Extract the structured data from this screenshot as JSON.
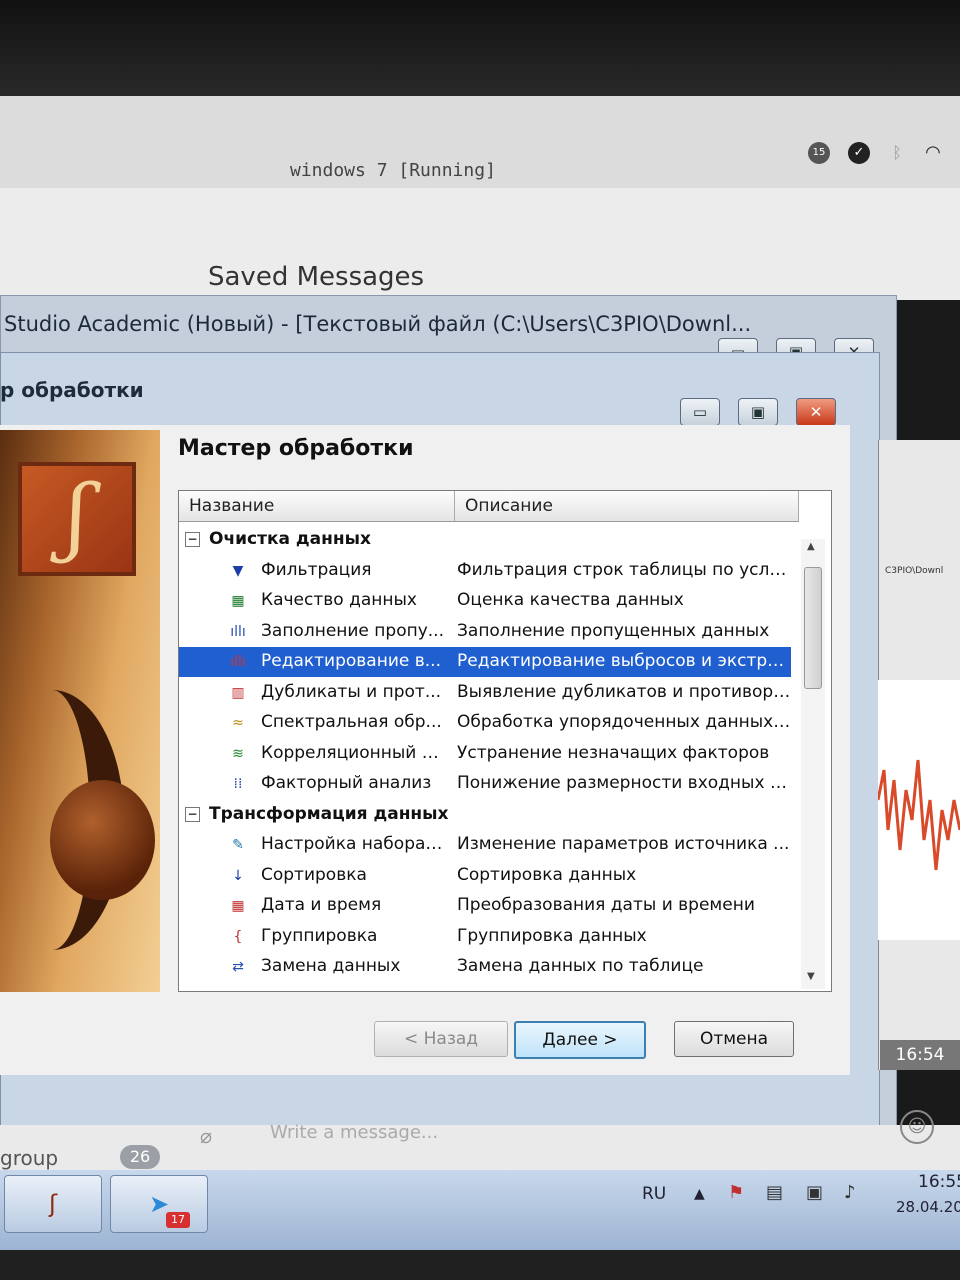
{
  "host": {
    "vm_title": "windows 7 [Running]",
    "telegram_chat_title": "Saved Messages",
    "tray_badge": "15"
  },
  "studio_window": {
    "title": "Studio Academic (Новый) - [Текстовый файл (C:\\Users\\C3PIO\\Downl..."
  },
  "wizard": {
    "title": "р обработки",
    "heading": "Мастер обработки",
    "columns": [
      "Название",
      "Описание"
    ],
    "groups": [
      {
        "label": "Очистка данных",
        "toggle": "−",
        "items": [
          {
            "icon": "funnel-icon",
            "glyph": "▼",
            "color": "#1a3fa8",
            "name": "Фильтрация",
            "desc": "Фильтрация строк таблицы по усло..."
          },
          {
            "icon": "quality-icon",
            "glyph": "▦",
            "color": "#1b7a2d",
            "name": "Качество данных",
            "desc": "Оценка качества данных"
          },
          {
            "icon": "fill-gaps-icon",
            "glyph": "ıllı",
            "color": "#2a4fb0",
            "name": "Заполнение пропу...",
            "desc": "Заполнение пропущенных данных"
          },
          {
            "icon": "outliers-icon",
            "glyph": "ıllı",
            "color": "#d83030",
            "name": "Редактирование в...",
            "desc": "Редактирование выбросов и экстре...",
            "selected": true
          },
          {
            "icon": "duplicates-icon",
            "glyph": "▥",
            "color": "#c03030",
            "name": "Дубликаты и прот...",
            "desc": "Выявление дубликатов и противоре..."
          },
          {
            "icon": "spectral-icon",
            "glyph": "≈",
            "color": "#b88a10",
            "name": "Спектральная обр...",
            "desc": "Обработка упорядоченных данных с..."
          },
          {
            "icon": "correlation-icon",
            "glyph": "≋",
            "color": "#1d8a2a",
            "name": "Корреляционный а...",
            "desc": "Устранение незначащих факторов"
          },
          {
            "icon": "factor-icon",
            "glyph": "⁞⁞",
            "color": "#2a4fb0",
            "name": "Факторный анализ",
            "desc": "Понижение размерности входных д..."
          }
        ]
      },
      {
        "label": "Трансформация данных",
        "toggle": "−",
        "items": [
          {
            "icon": "wrench-icon",
            "glyph": "✎",
            "color": "#1f77a8",
            "name": "Настройка набора ...",
            "desc": "Изменение параметров источника ..."
          },
          {
            "icon": "sort-icon",
            "glyph": "↓",
            "color": "#1a3fa8",
            "name": "Сортировка",
            "desc": "Сортировка данных"
          },
          {
            "icon": "calendar-icon",
            "glyph": "▦",
            "color": "#c03030",
            "name": "Дата и время",
            "desc": "Преобразования даты и времени"
          },
          {
            "icon": "group-icon",
            "glyph": "{",
            "color": "#c03030",
            "name": "Группировка",
            "desc": "Группировка данных"
          },
          {
            "icon": "replace-icon",
            "glyph": "⇄",
            "color": "#2a4fb0",
            "name": "Замена данных",
            "desc": "Замена данных по таблице"
          }
        ]
      }
    ],
    "buttons": {
      "back": "< Назад",
      "next": "Далее >",
      "cancel": "Отмена"
    }
  },
  "right_window": {
    "time": "16:54",
    "title_fragment": "C3PIO\\Downl"
  },
  "telegram": {
    "group_label": "group",
    "unread": "26",
    "input_placeholder": "Write a message..."
  },
  "taskbar": {
    "lang": "RU",
    "time": "16:55",
    "date": "28.04.20",
    "telegram_badge": "17"
  }
}
